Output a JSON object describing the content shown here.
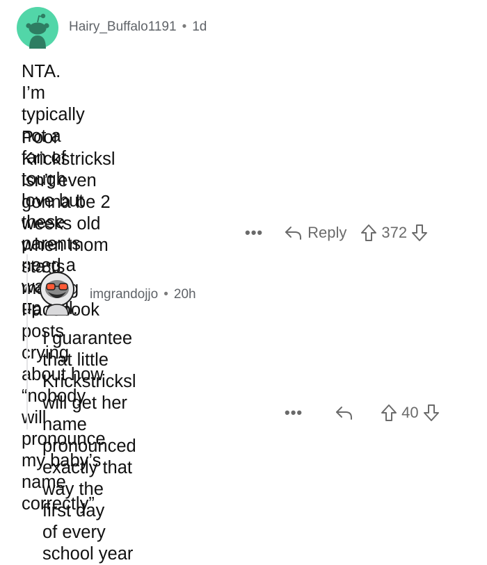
{
  "colors": {
    "avatar_bg_1": "#52d6a8",
    "avatar_fg_1": "#2e7d62",
    "meta_text": "#5f6368",
    "action_icon": "#6a6a6a",
    "thread_line": "#e4e4e6"
  },
  "comments": [
    {
      "username": "Hairy_Buffalo1191",
      "separator": "•",
      "age": "1d",
      "avatar_icon": "snoo-avatar-icon",
      "body": "NTA. I’m typically not a fan of tough love but\nthese parents need a wake up call.",
      "body2": "Poor Krickstricksl isn’t even gonna be 2 weeks old\nwhen mom starts making Facebook posts crying\nabout how “nobody will pronounce my baby’s\nname correctly”",
      "more_label": "•••",
      "reply_label": "Reply",
      "score": "372"
    },
    {
      "username": "imgrandojjo",
      "separator": "•",
      "age": "20h",
      "avatar_icon": "snoo-astronaut-avatar-icon",
      "body": "I guarantee that little Krickstricksl will get her\nname pronounced exactly that way the first day\nof every school year",
      "more_label": "•••",
      "score": "40"
    }
  ]
}
